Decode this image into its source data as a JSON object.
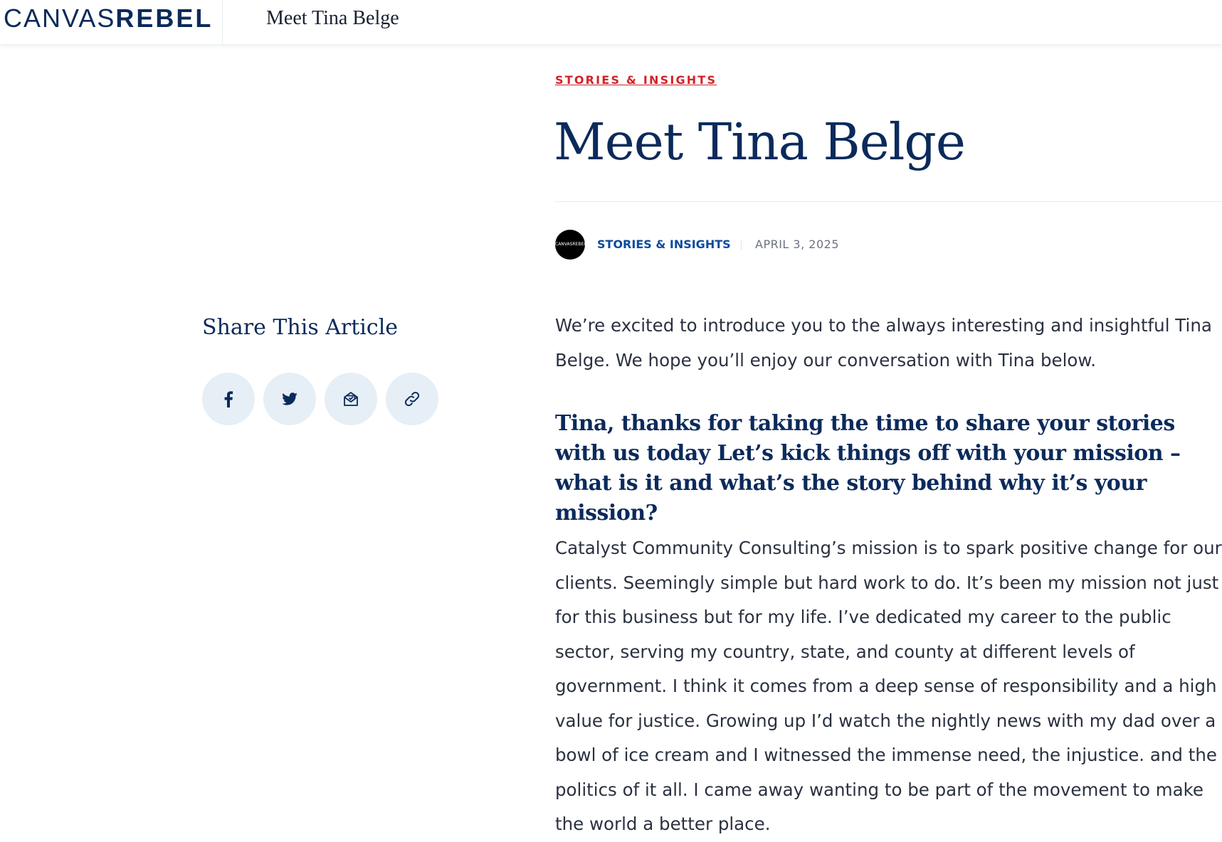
{
  "header": {
    "logo_thin": "CANVAS",
    "logo_bold": "REBEL",
    "page_title": "Meet Tina Belge"
  },
  "article": {
    "category": "STORIES & INSIGHTS",
    "title": "Meet Tina Belge",
    "avatar_text": "CANVASREBEL",
    "byline_category": "STORIES & INSIGHTS",
    "date": "APRIL 3, 2025",
    "intro": "We’re excited to introduce you to the always interesting and insightful Tina Belge.  We hope you’ll enjoy our conversation with Tina below.",
    "question": "Tina, thanks for taking the time to share your stories with us today Let’s kick things off with your mission – what is it and what’s the story behind why it’s your mission?",
    "answer": "Catalyst Community Consulting’s mission is to spark positive change for our clients.  Seemingly simple but hard work to do. It’s been my mission not just for this business but for my life. I’ve dedicated my career to the public sector, serving my country, state, and county at different levels of government. I think it comes from a deep sense of responsibility and a high value for justice. Growing up I’d watch the nightly news with my dad over a bowl of ice cream and I witnessed the immense need, the injustice. and the politics of it all. I came away wanting to be part of the movement to make the world a better place."
  },
  "share": {
    "title": "Share This Article",
    "buttons": [
      {
        "icon": "facebook-icon"
      },
      {
        "icon": "twitter-icon"
      },
      {
        "icon": "email-icon"
      },
      {
        "icon": "link-icon"
      }
    ]
  },
  "colors": {
    "brand_navy": "#0b2a5b",
    "accent_red": "#d2232a",
    "link_blue": "#0b4a9b",
    "share_bg": "#e6eef6"
  }
}
